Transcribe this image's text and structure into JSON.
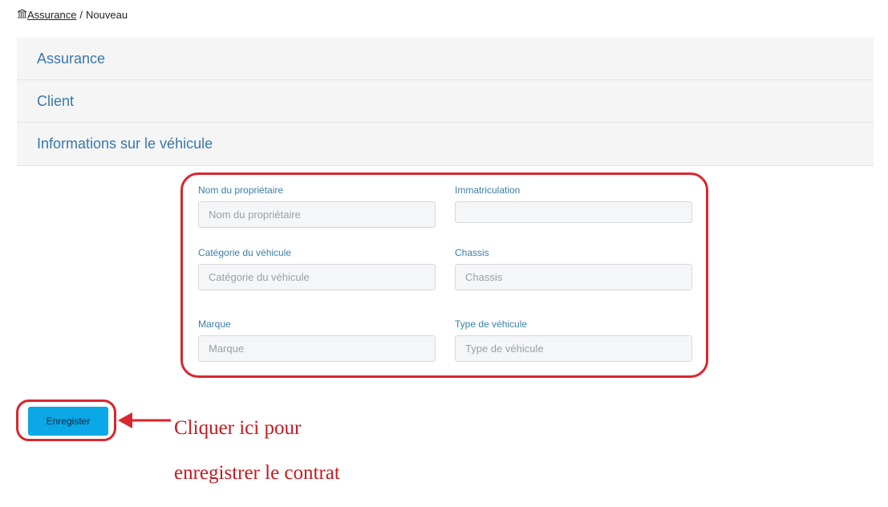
{
  "breadcrumb": {
    "link": "Assurance",
    "separator": "/",
    "current": "Nouveau"
  },
  "accordion": {
    "items": [
      {
        "label": "Assurance"
      },
      {
        "label": "Client"
      },
      {
        "label": "Informations sur le véhicule"
      }
    ]
  },
  "vehicle_form": {
    "owner": {
      "label": "Nom du propriétaire",
      "placeholder": "Nom du propriétaire",
      "value": ""
    },
    "registration": {
      "label": "Immatriculation",
      "placeholder": "",
      "value": ""
    },
    "category": {
      "label": "Catégorie du véhicule",
      "placeholder": "Catégorie du véhicule",
      "value": ""
    },
    "chassis": {
      "label": "Chassis",
      "placeholder": "Chassis",
      "value": ""
    },
    "brand": {
      "label": "Marque",
      "placeholder": "Marque",
      "value": ""
    },
    "vehicle_type": {
      "label": "Type de véhicule",
      "placeholder": "Type de véhicule",
      "value": ""
    }
  },
  "actions": {
    "save_label": "Enregister"
  },
  "annotation": {
    "line1": "Cliquer ici pour",
    "line2": "enregistrer le contrat"
  },
  "colors": {
    "accent": "#3877ac",
    "annotation": "#d9262f",
    "button": "#0aa8e6"
  },
  "icons": {
    "breadcrumb_home": "institution-icon"
  }
}
